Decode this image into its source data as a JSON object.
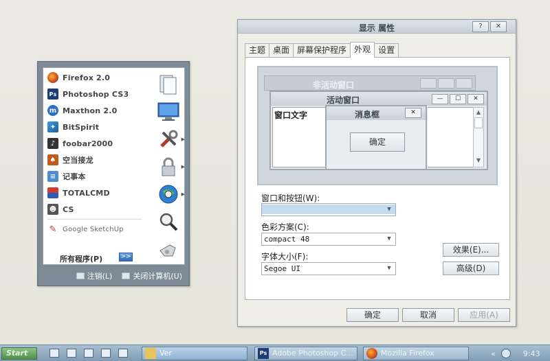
{
  "start_menu": {
    "programs": [
      {
        "label": "Firefox 2.0",
        "icon": "firefox-icon"
      },
      {
        "label": "Photoshop CS3",
        "icon": "photoshop-icon"
      },
      {
        "label": "Maxthon 2.0",
        "icon": "maxthon-icon"
      },
      {
        "label": "BitSpirit",
        "icon": "bitspirit-icon"
      },
      {
        "label": "foobar2000",
        "icon": "foobar-icon"
      },
      {
        "label": "空当接龙",
        "icon": "freecell-icon"
      },
      {
        "label": "记事本",
        "icon": "notepad-icon"
      },
      {
        "label": "TOTALCMD",
        "icon": "totalcmd-icon"
      },
      {
        "label": "CS",
        "icon": "cs-icon"
      },
      {
        "label": "Google SketchUp",
        "icon": "sketchup-icon"
      }
    ],
    "all_programs": "所有程序(P)",
    "right_icons": [
      "documents-icon",
      "monitor-icon",
      "tools-icon",
      "lock-icon",
      "network-globe-icon",
      "search-magnifier-icon",
      "whistle-icon"
    ],
    "logoff": "注销(L)",
    "shutdown": "关闭计算机(U)"
  },
  "dialog": {
    "title": "显示 属性",
    "help_btn": "?",
    "close_btn": "✕",
    "tabs": [
      "主题",
      "桌面",
      "屏幕保护程序",
      "外观",
      "设置"
    ],
    "active_tab": "外观",
    "preview": {
      "inactive_title": "非活动窗口",
      "active_title": "活动窗口",
      "window_text": "窗口文字",
      "message_title": "消息框",
      "ok_label": "确定"
    },
    "windows_buttons_label": "窗口和按钮(W):",
    "windows_buttons_value": "",
    "color_scheme_label": "色彩方案(C):",
    "color_scheme_value": "compact 48",
    "font_size_label": "字体大小(F):",
    "font_size_value": "Segoe UI",
    "effects_btn": "效果(E)...",
    "advanced_btn": "高级(D)",
    "ok_btn": "确定",
    "cancel_btn": "取消",
    "apply_btn": "应用(A)"
  },
  "taskbar": {
    "start": "Start",
    "tasks": [
      {
        "label": "Ver",
        "icon": "folder-icon"
      },
      {
        "label": "Adobe Photoshop C...",
        "icon": "photoshop-icon"
      },
      {
        "label": "Mozilla Firefox",
        "icon": "firefox-icon"
      }
    ],
    "tray_arrow": "«",
    "clock": "9:43"
  }
}
